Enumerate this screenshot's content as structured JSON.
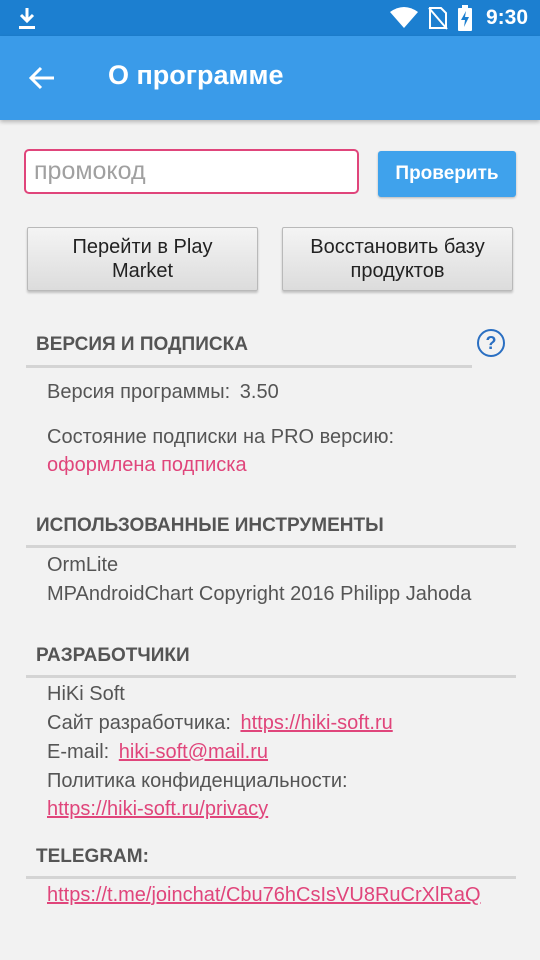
{
  "status_bar": {
    "time": "9:30",
    "icons": [
      "download-icon",
      "wifi-icon",
      "sim-off-icon",
      "battery-charging-icon"
    ]
  },
  "app_bar": {
    "title": "О программе",
    "back_icon": "arrow-back-icon"
  },
  "promo": {
    "placeholder": "промокод",
    "value": "",
    "check_label": "Проверить"
  },
  "buttons": {
    "play_market_line1": "Перейти в Play",
    "play_market_line2": "Market",
    "restore_line1": "Восстановить базу",
    "restore_line2": "продуктов"
  },
  "version_section": {
    "title": "ВЕРСИЯ И ПОДПИСКА",
    "help_icon": "question-icon",
    "help_glyph": "?",
    "version_label": "Версия программы:",
    "version_value": "3.50",
    "subscription_label": "Состояние подписки на PRO версию:",
    "subscription_status": "оформлена подписка"
  },
  "tools_section": {
    "title": "ИСПОЛЬЗОВАННЫЕ ИНСТРУМЕНТЫ",
    "items": [
      "OrmLite",
      "MPAndroidChart Copyright 2016 Philipp Jahoda"
    ]
  },
  "dev_section": {
    "title": "РАЗРАБОТЧИКИ",
    "company": "HiKi Soft",
    "site_label": "Сайт разработчика:",
    "site_url": "https://hiki-soft.ru",
    "email_label": "E-mail:",
    "email": "hiki-soft@mail.ru",
    "privacy_label": "Политика конфиденциальности:",
    "privacy_url": "https://hiki-soft.ru/privacy"
  },
  "telegram_section": {
    "title": "TELEGRAM:",
    "url": "https://t.me/joinchat/Cbu76hCsIsVU8RuCrXlRaQ"
  },
  "colors": {
    "status_bar": "#1c7fd0",
    "app_bar": "#3a9be9",
    "accent_pink": "#e0457b",
    "check_button": "#3fa2ec"
  }
}
